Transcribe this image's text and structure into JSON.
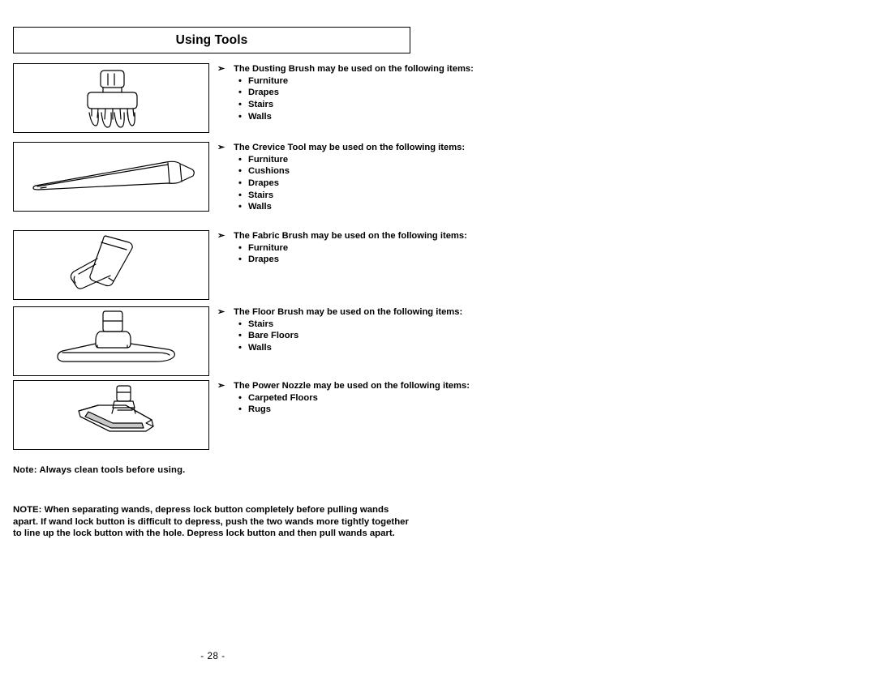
{
  "header": {
    "title": "Using Tools"
  },
  "tools": [
    {
      "icon": "dusting-brush-icon",
      "lead": "The Dusting Brush may be used on the following items:",
      "items": [
        "Furniture",
        "Drapes",
        "Stairs",
        "Walls"
      ]
    },
    {
      "icon": "crevice-tool-icon",
      "lead": "The Crevice Tool may be used on the following items:",
      "items": [
        "Furniture",
        "Cushions",
        "Drapes",
        "Stairs",
        "Walls"
      ]
    },
    {
      "icon": "fabric-brush-icon",
      "lead": "The Fabric Brush may be used on the following items:",
      "items": [
        "Furniture",
        "Drapes"
      ]
    },
    {
      "icon": "floor-brush-icon",
      "lead": "The Floor Brush may be used on the following items:",
      "items": [
        "Stairs",
        "Bare Floors",
        "Walls"
      ]
    },
    {
      "icon": "power-nozzle-icon",
      "lead": "The Power Nozzle may be used on the following items:",
      "items": [
        "Carpeted Floors",
        "Rugs"
      ]
    }
  ],
  "notes": {
    "clean_tools": "Note:  Always clean tools before using.",
    "wand_note": "NOTE: When separating wands, depress lock button completely before pulling wands apart. If wand lock button is difficult to depress, push the two wands more tightly together to line up the lock button with the hole. Depress lock button and then pull wands apart."
  },
  "footer": {
    "page_number": "- 28 -"
  },
  "arrow_glyph": "➢",
  "colors": {
    "ink": "#000000",
    "page": "#ffffff"
  }
}
